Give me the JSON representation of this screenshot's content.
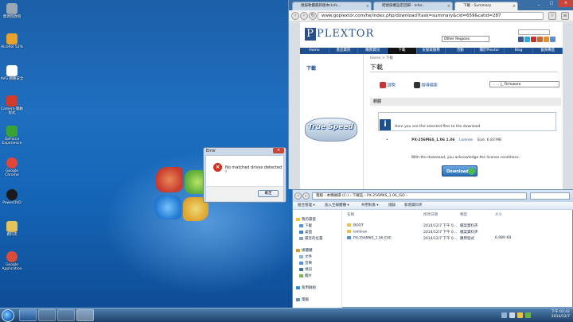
{
  "desktop": {
    "icons": [
      {
        "label": "資源回收筒",
        "color": "#9aa7b5"
      },
      {
        "label": "Alcohol 52%",
        "color": "#e8a12b"
      },
      {
        "label": "AVG 網路安全",
        "color": "#ffffff"
      },
      {
        "label": "Camera 驅動程式",
        "color": "#d23a2a"
      },
      {
        "label": "GeForce Experience",
        "color": "#3aa335"
      },
      {
        "label": "Google Chrome",
        "color": "#e0463a"
      },
      {
        "label": "PowerDVD",
        "color": "#1a1a1a"
      },
      {
        "label": "資料夾",
        "color": "#e3c35a"
      },
      {
        "label": "Google Application",
        "color": "#d94b3a"
      }
    ]
  },
  "browser": {
    "tabs": [
      "燒錄軟體最新版本(Info...",
      "把燒錄機設定回歸 - Infor...",
      "下載 - Summary"
    ],
    "close_glyph": "×",
    "url": "www.goplextor.com/tw/index.php/download?task=summary&cid=659&catid=287",
    "site": {
      "logo": "PLEXTOR",
      "region": "Other Regions",
      "nav": [
        "Home",
        "產品資訊",
        "購買資訊",
        "下載",
        "支援與服務",
        "活動",
        "關於Plextor",
        "Blog",
        "會員專區"
      ],
      "breadcrumb": "Home > 下載",
      "heading": "下載",
      "left_title": "下載",
      "banner_text": "True Speed",
      "opt1": "說明",
      "opt2": "搜尋檔案",
      "firmware_select": ". . . |_ Firmware",
      "section": "韌體",
      "note": "Here you see the selected files to the download",
      "file_bullet": "•",
      "file_name": "PX-256M6S_1.06 1.06",
      "file_license": "License",
      "file_size": "Size: 6.83 MB",
      "agree": "With the download, you acknowledge the license conditions.",
      "download_btn": "Download"
    }
  },
  "explorer": {
    "path": "電腦 › 本機磁碟 (C:) › 下載區 › PX-256M6S_1.06_ISO ›",
    "toolbar": [
      "組合管理 ▾",
      "加入至媒體櫃 ▾",
      "共用對象 ▾",
      "燒錄",
      "新增資料夾"
    ],
    "sidebar": [
      {
        "label": "我的最愛",
        "color": "#e8c34a"
      },
      {
        "label": "下載",
        "color": "#5a8fd0"
      },
      {
        "label": "桌面",
        "color": "#4a7fc2"
      },
      {
        "label": "最近的位置",
        "color": "#8aa0b8"
      },
      {
        "label": "媒體櫃",
        "color": "#caa33a"
      },
      {
        "label": "文件",
        "color": "#8ab0d8"
      },
      {
        "label": "音樂",
        "color": "#5a8fd0"
      },
      {
        "label": "視訊",
        "color": "#4a6f9a"
      },
      {
        "label": "圖片",
        "color": "#7ab05a"
      },
      {
        "label": "家用群組",
        "color": "#3a8ad0"
      },
      {
        "label": "電腦",
        "color": "#6a8fb5"
      }
    ],
    "columns": [
      "名稱",
      "修改日期",
      "類型",
      "大小"
    ],
    "rows": [
      {
        "name": "BOOT",
        "date": "2014/12/7 下午 0...",
        "type": "檔案資料夾",
        "size": ""
      },
      {
        "name": "isolinux",
        "date": "2014/12/7 下午 0...",
        "type": "檔案資料夾",
        "size": ""
      },
      {
        "name": "PX-256M6S_1.06.EXE",
        "date": "2014/12/7 下午 0...",
        "type": "應用程式",
        "size": "6,989 KB"
      }
    ]
  },
  "dialog": {
    "title": "Error",
    "message": "No matched drives detected !",
    "ok": "確定",
    "close": "×",
    "error_glyph": "×"
  },
  "taskbar": {
    "time": "下午 02:42",
    "date": "2014/12/7"
  }
}
